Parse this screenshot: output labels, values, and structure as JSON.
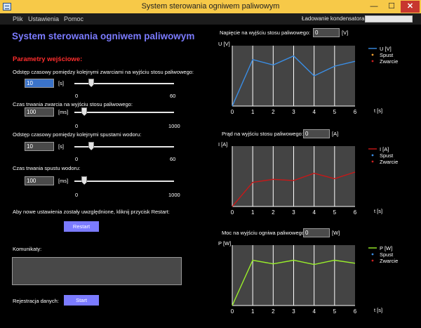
{
  "window": {
    "title": "System sterowania ogniwem paliwowym",
    "minimize": "—",
    "maximize": "☐",
    "close": "✕"
  },
  "menu": {
    "items": [
      "Plik",
      "Ustawienia",
      "Pomoc"
    ],
    "progress_label": "Ładowanie kondensatora:",
    "progress_value": 0
  },
  "app_title": "System sterowania ogniwem paliwowym",
  "params": {
    "header": "Parametry wejściowe:",
    "p1": {
      "label": "Odstęp czasowy pomiędzy kolejnymi zwarciami na wyjściu stosu paliwowego:",
      "value": "10",
      "unit": "[s]",
      "min": "0",
      "max": "60",
      "level": 0.17
    },
    "p2": {
      "label": "Czas trwania zwarcia na wyjściu stosu paliwowego:",
      "value": "100",
      "unit": "[ms]",
      "min": "0",
      "max": "1000",
      "level": 0.1
    },
    "p3": {
      "label": "Odstęp czasowy pomiędzy kolejnymi spustami wodoru:",
      "value": "10",
      "unit": "[s]",
      "min": "0",
      "max": "60",
      "level": 0.17
    },
    "p4": {
      "label": "Czas trwania spustu wodoru:",
      "value": "100",
      "unit": "[ms]",
      "min": "0",
      "max": "1000",
      "level": 0.1
    },
    "restart_note": "Aby nowe ustawienia zostały uwzględnione, kliknij przycisk Restart:",
    "restart_button": "Restart"
  },
  "messages_label": "Komunikaty:",
  "registration": {
    "label": "Rejestracja danych:",
    "start_button": "Start"
  },
  "readouts": [
    {
      "label": "Napięcie na wyjściu stosu paliwowego:",
      "value": "0",
      "unit": "[V]"
    },
    {
      "label": "Prąd na wyjściu stosu paliwowego:",
      "value": "0",
      "unit": "[A]"
    },
    {
      "label": "Moc na wyjściu ogniwa paliwowego:",
      "value": "0",
      "unit": "[W]"
    }
  ],
  "chart_data": [
    {
      "type": "line",
      "ylabel": "U [V]",
      "xlabel": "t [s]",
      "categories": [
        "0",
        "1",
        "2",
        "3",
        "4",
        "5",
        "6"
      ],
      "xlim": [
        0,
        6
      ],
      "ylim": [
        0,
        10
      ],
      "grid": true,
      "legend": "top-right",
      "series": [
        {
          "name": "U [V]",
          "color": "#3a8ee6",
          "marker": "line",
          "values": [
            0,
            7.7,
            6.8,
            8.3,
            5.0,
            6.6,
            7.4
          ]
        },
        {
          "name": "Spust",
          "color": "#f0a030",
          "marker": "point",
          "values": []
        },
        {
          "name": "Zwarcie",
          "color": "#cc2020",
          "marker": "point",
          "values": []
        }
      ]
    },
    {
      "type": "line",
      "ylabel": "I [A]",
      "xlabel": "t [s]",
      "categories": [
        "0",
        "1",
        "2",
        "3",
        "4",
        "5",
        "6"
      ],
      "xlim": [
        0,
        6
      ],
      "ylim": [
        0,
        10
      ],
      "grid": true,
      "legend": "top-right",
      "series": [
        {
          "name": "I [A]",
          "color": "#c81818",
          "marker": "line",
          "values": [
            0,
            4.0,
            4.5,
            4.3,
            5.5,
            4.6,
            5.7
          ]
        },
        {
          "name": "Spust",
          "color": "#3a8ee6",
          "marker": "point",
          "values": []
        },
        {
          "name": "Zwarcie",
          "color": "#cc2020",
          "marker": "point",
          "values": []
        }
      ]
    },
    {
      "type": "line",
      "ylabel": "P [W]",
      "xlabel": "t [s]",
      "categories": [
        "0",
        "1",
        "2",
        "3",
        "4",
        "5",
        "6"
      ],
      "xlim": [
        0,
        6
      ],
      "ylim": [
        0,
        10
      ],
      "grid": true,
      "legend": "top-right",
      "series": [
        {
          "name": "P [W]",
          "color": "#9af02a",
          "marker": "line",
          "values": [
            0,
            7.5,
            6.9,
            7.5,
            6.8,
            7.5,
            7.0
          ]
        },
        {
          "name": "Spust",
          "color": "#3a8ee6",
          "marker": "point",
          "values": []
        },
        {
          "name": "Zwarcie",
          "color": "#cc2020",
          "marker": "point",
          "values": []
        }
      ]
    }
  ]
}
